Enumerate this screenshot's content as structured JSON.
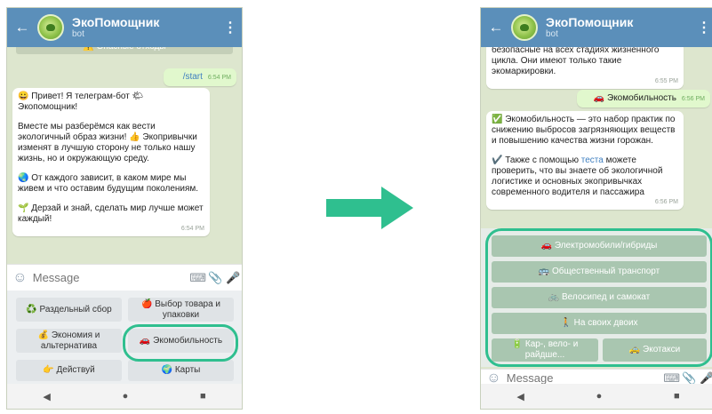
{
  "app": {
    "bot_name": "ЭкоПомощник",
    "bot_subtitle": "bot"
  },
  "icons": {
    "back": "back-arrow-icon",
    "menu": "more-vert-icon",
    "emoji": "sticker-icon",
    "attach": "paperclip-icon",
    "mic": "microphone-icon",
    "keyboard": "keyboard-icon"
  },
  "colors": {
    "header": "#5b8fba",
    "chat_bg": "#dde6ce",
    "highlight": "#2fbf8f",
    "arrow": "#2fbf8f"
  },
  "left": {
    "pinned": "⚠️ Опасные отходы",
    "start_msg": {
      "text": "/start",
      "time": "6:54 PM"
    },
    "welcome": {
      "p1": "😀 Привет! Я телеграм-бот 🌤 Экопомощник!",
      "p2": "Вместе мы разберёмся как вести экологичный образ жизни! 👍 Экопривычки изменят в лучшую сторону не только нашу жизнь, но и окружающую среду.",
      "p3": "🌏 От каждого зависит, в каком мире мы живем и что оставим будущим поколениям.",
      "p4": "🌱 Дерзай и знай, сделать мир лучше может каждый!",
      "time": "6:54 PM"
    },
    "composer_placeholder": "Message",
    "keyboard": [
      "♻️ Раздельный сбор",
      "🍎 Выбор товара и упаковки",
      "💰 Экономия и альтернатива",
      "🚗 Экомобильность",
      "👉 Действуй",
      "🌍 Карты"
    ]
  },
  "right": {
    "prev_msg": {
      "text": "безопасные на всех стадиях жизненного цикла. Они имеют только такие экомаркировки.",
      "time": "6:55 PM"
    },
    "eco_msg": {
      "text": "🚗 Экомобильность",
      "time": "6:56 PM"
    },
    "info": {
      "p1": "✅ Экомобильность — это набор практик по снижению выбросов загрязняющих веществ и повышению качества жизни горожан.",
      "p2_a": "✔️ Также с помощью ",
      "p2_link": "теста",
      "p2_b": " можете проверить, что вы знаете об экологичной логистике и основных экопривычках современного водителя и пассажира",
      "time": "6:56 PM"
    },
    "keyboard": [
      "🚗 Электромобили/гибриды",
      "🚌 Общественный транспорт",
      "🚲 Велосипед и самокат",
      "🚶 На своих двоих",
      "🔋 Кар-, вело- и райдше...",
      "🚕 Экотакси"
    ],
    "composer_placeholder": "Message"
  },
  "navbar": {
    "back": "◀",
    "home": "●",
    "recents": "■"
  }
}
